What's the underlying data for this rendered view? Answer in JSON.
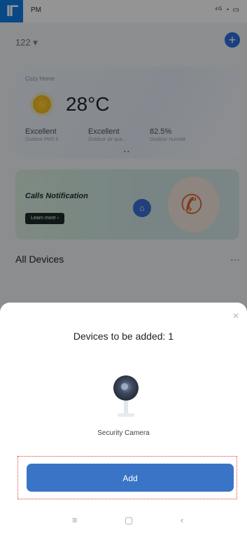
{
  "status_bar": {
    "badge": "IΓ",
    "time": "PM",
    "icons": "⁴ᴳ ◔ ▭"
  },
  "header": {
    "home_name": "122 ▾",
    "add_icon": "plus-circle-icon"
  },
  "weather": {
    "label": "Cozy Home",
    "temperature": "28°C",
    "metrics": [
      {
        "value": "Excellent",
        "label": "Outdoor PM2.5"
      },
      {
        "value": "Excellent",
        "label": "Outdoor air qua..."
      },
      {
        "value": "82.5%",
        "label": "Outdoor Humidit"
      }
    ],
    "page_dots": "• •"
  },
  "banner": {
    "title": "Calls Notification",
    "button": "Learn more ›"
  },
  "devices_section": {
    "title": "All Devices",
    "more": "···"
  },
  "sheet": {
    "title": "Devices to be added: 1",
    "device_name": "Security Camera",
    "add_label": "Add",
    "close_glyph": "×"
  },
  "nav": {
    "menu": "≡",
    "home": "▢",
    "back": "‹"
  },
  "colors": {
    "accent": "#3a74c6",
    "highlight": "#e23b3b"
  }
}
